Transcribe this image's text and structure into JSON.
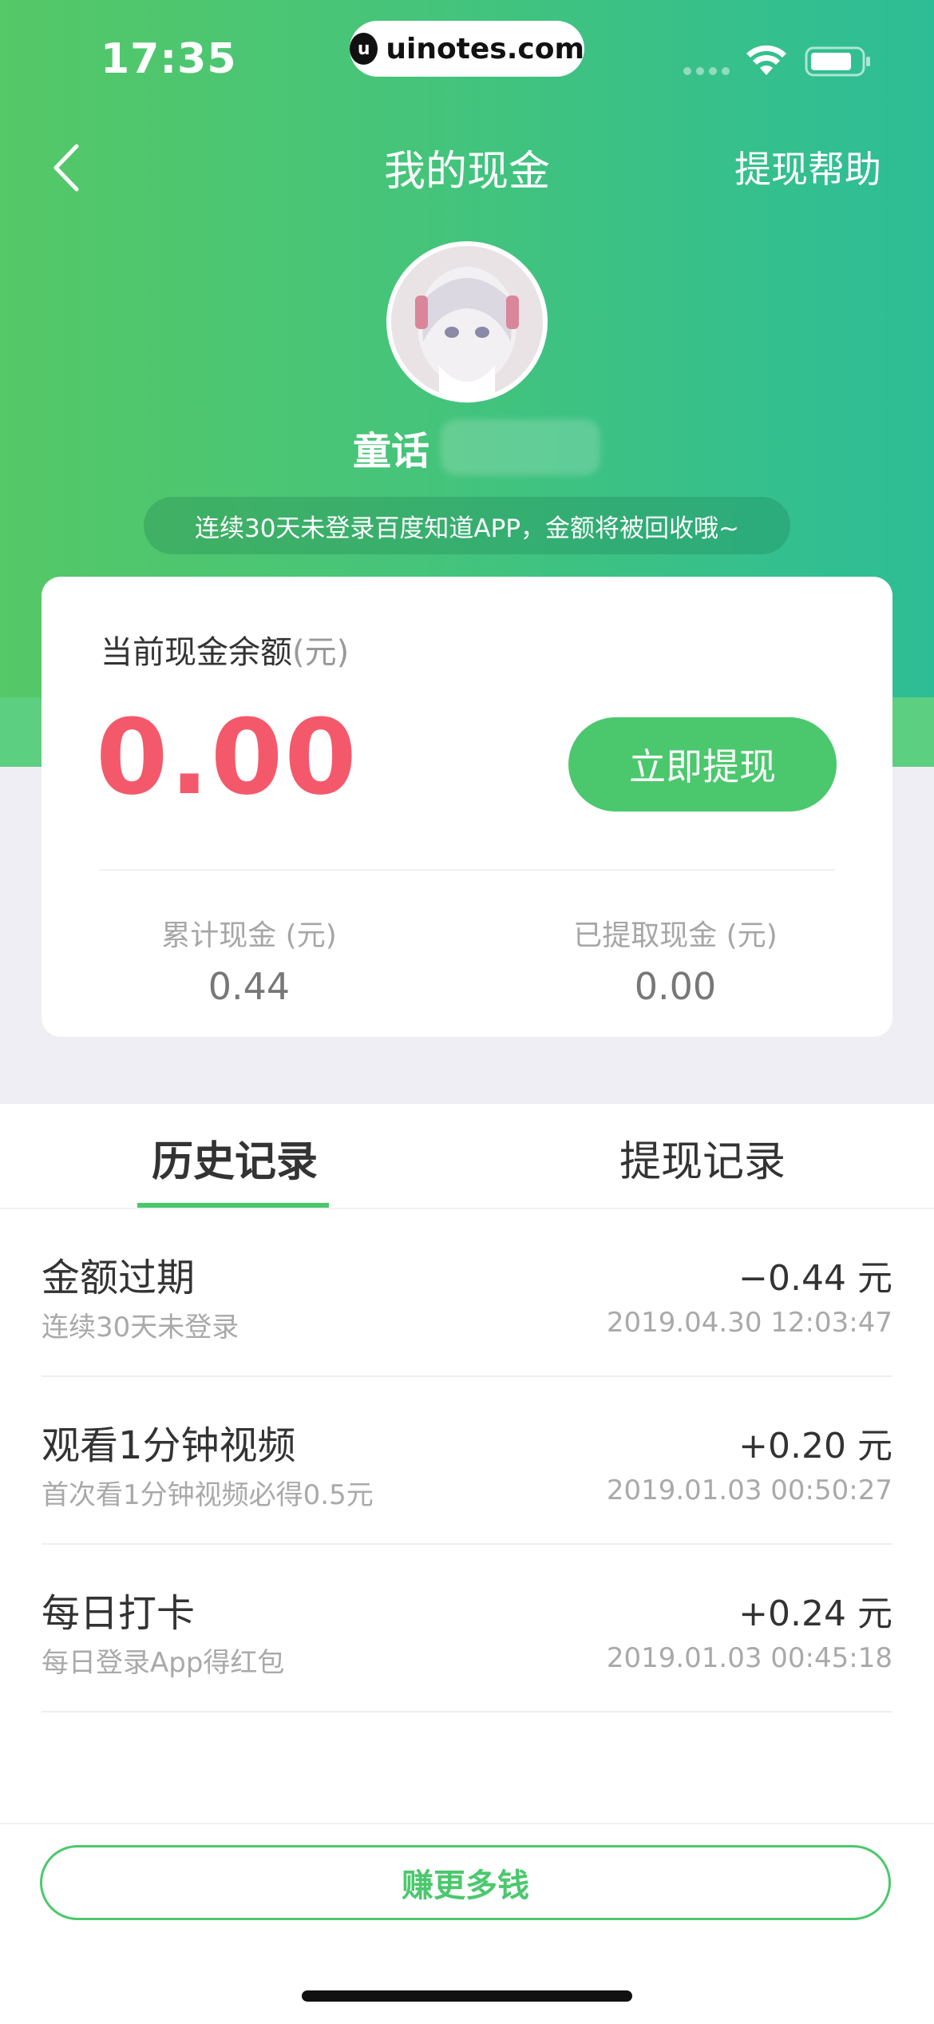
{
  "status_bar": {
    "time": "17:35",
    "watermark": "uinotes.com",
    "watermark_logo": "u"
  },
  "nav": {
    "title": "我的现金",
    "help": "提现帮助",
    "back_icon": "chevron-left-icon"
  },
  "profile": {
    "username": "童话",
    "notice": "连续30天未登录百度知道APP，金额将被回收哦~"
  },
  "balance": {
    "label": "当前现金余额",
    "label_unit": "(元)",
    "value": "0.00",
    "withdraw_button": "立即提现",
    "total_label": "累计现金 (元)",
    "total_value": "0.44",
    "withdrawn_label": "已提取现金 (元)",
    "withdrawn_value": "0.00"
  },
  "tabs": {
    "history": "历史记录",
    "withdrawals": "提现记录"
  },
  "records": [
    {
      "title": "金额过期",
      "desc": "连续30天未登录",
      "amount": "−0.44 元",
      "time": "2019.04.30 12:03:47"
    },
    {
      "title": "观看1分钟视频",
      "desc": "首次看1分钟视频必得0.5元",
      "amount": "+0.20 元",
      "time": "2019.01.03 00:50:27"
    },
    {
      "title": "每日打卡",
      "desc": "每日登录App得红包",
      "amount": "+0.24 元",
      "time": "2019.01.03 00:45:18"
    }
  ],
  "footer": {
    "earn_button": "赚更多钱"
  },
  "colors": {
    "brand_green": "#4bc86d",
    "balance_red": "#f4596b"
  }
}
